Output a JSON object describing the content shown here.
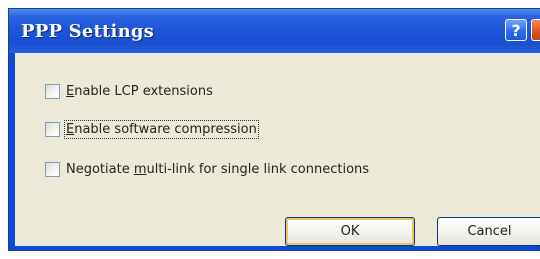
{
  "window": {
    "title": "PPP Settings",
    "help_glyph": "?"
  },
  "options": [
    {
      "pre": "",
      "accel": "E",
      "post": "nable LCP extensions",
      "checked": false
    },
    {
      "pre": "",
      "accel": "E",
      "post": "nable software compression",
      "checked": false
    },
    {
      "pre": "Negotiate ",
      "accel": "m",
      "post": "ulti-link for single link connections",
      "checked": false
    }
  ],
  "buttons": {
    "ok_label": "OK",
    "cancel_label": "Cancel"
  },
  "colors": {
    "titlebar": "#1b55d8",
    "face": "#ece9d8",
    "default_button_glow": "#f0c16a"
  }
}
